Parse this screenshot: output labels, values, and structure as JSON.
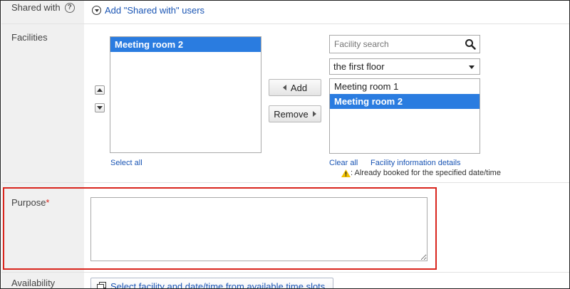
{
  "shared_with": {
    "label": "Shared with",
    "help_icon": "question-circle-icon",
    "add_link": "Add \"Shared with\" users"
  },
  "facilities": {
    "label": "Facilities",
    "selected_items": [
      "Meeting room 2"
    ],
    "select_all": "Select all",
    "add_button": "Add",
    "remove_button": "Remove",
    "search_placeholder": "Facility search",
    "group_value": "the first floor",
    "available_items": [
      "Meeting room 1",
      "Meeting room 2"
    ],
    "clear_all": "Clear all",
    "info_link": "Facility information details",
    "booked_note": ": Already booked for the specified date/time"
  },
  "purpose": {
    "label": "Purpose",
    "required_mark": "*",
    "value": ""
  },
  "availability": {
    "label": "Availability",
    "button": "Select facility and date/time from available time slots"
  },
  "colors": {
    "highlight_border": "#d9251d",
    "selection": "#2a7ce0",
    "link": "#1a55b4",
    "warning": "#f2c200"
  }
}
